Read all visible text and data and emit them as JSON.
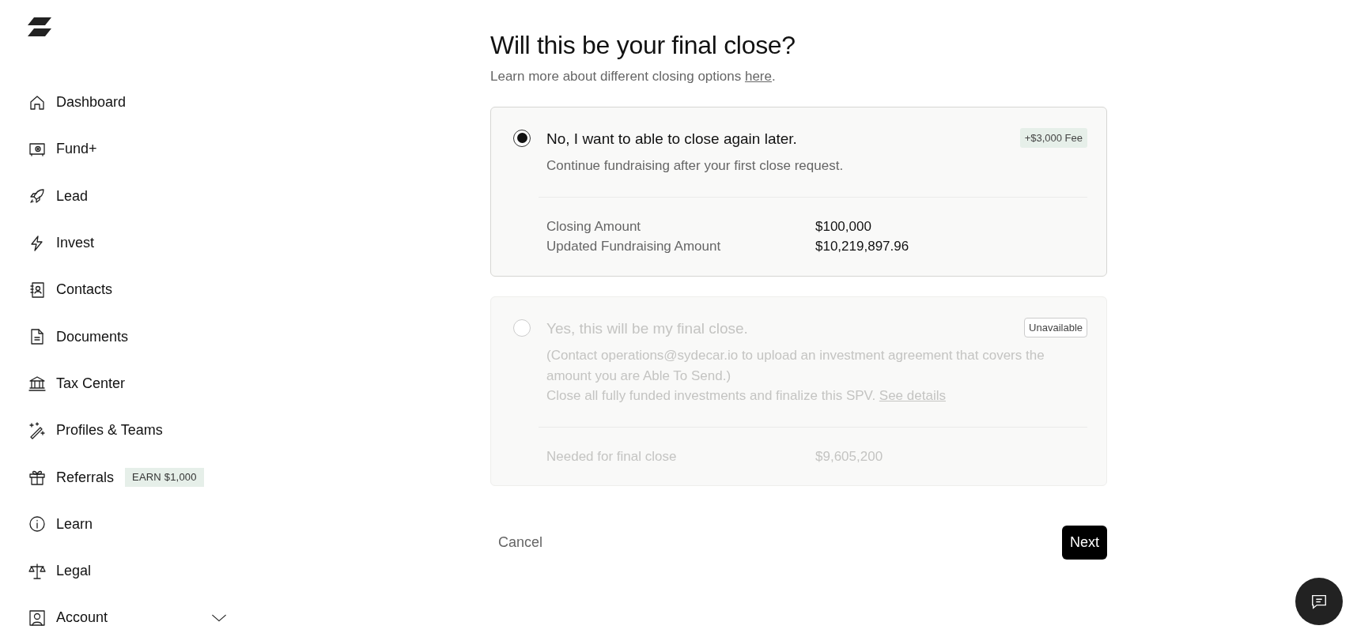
{
  "sidebar": {
    "items": [
      {
        "label": "Dashboard"
      },
      {
        "label": "Fund+"
      },
      {
        "label": "Lead"
      },
      {
        "label": "Invest"
      },
      {
        "label": "Contacts"
      },
      {
        "label": "Documents"
      },
      {
        "label": "Tax Center"
      },
      {
        "label": "Profiles & Teams"
      },
      {
        "label": "Referrals",
        "badge": "EARN $1,000"
      },
      {
        "label": "Learn"
      },
      {
        "label": "Legal"
      },
      {
        "label": "Account",
        "expanded": false
      }
    ]
  },
  "heading": {
    "title": "Will this be your final close?",
    "subtitle": "Learn more about different closing options ",
    "link": "here",
    "after": "."
  },
  "options": [
    {
      "label": "No, I want to able to close again later.",
      "selected": true,
      "disabled": false,
      "tag": {
        "kind": "fee",
        "text": "+$3,000 Fee"
      },
      "paragraphs": [
        {
          "text": "Continue fundraising after your first close request."
        }
      ],
      "rows": [
        {
          "label": "Closing Amount",
          "value": "$100,000"
        },
        {
          "label": "Updated Fundraising Amount",
          "value": "$10,219,897.96"
        }
      ]
    },
    {
      "label": "Yes, this will be my final close.",
      "selected": false,
      "disabled": true,
      "tag": {
        "kind": "status",
        "text": "Unavailable"
      },
      "paragraphs": [
        {
          "text": "(Contact operations@sydecar.io to upload an investment agreement that covers the amount you are Able To Send.)"
        },
        {
          "text": "Close all fully funded investments and finalize this SPV. ",
          "link": "See details"
        }
      ],
      "rows": [
        {
          "label": "Needed for final close",
          "value": "$9,605,200"
        }
      ]
    }
  ],
  "actions": {
    "cancel": "Cancel",
    "next": "Next"
  }
}
